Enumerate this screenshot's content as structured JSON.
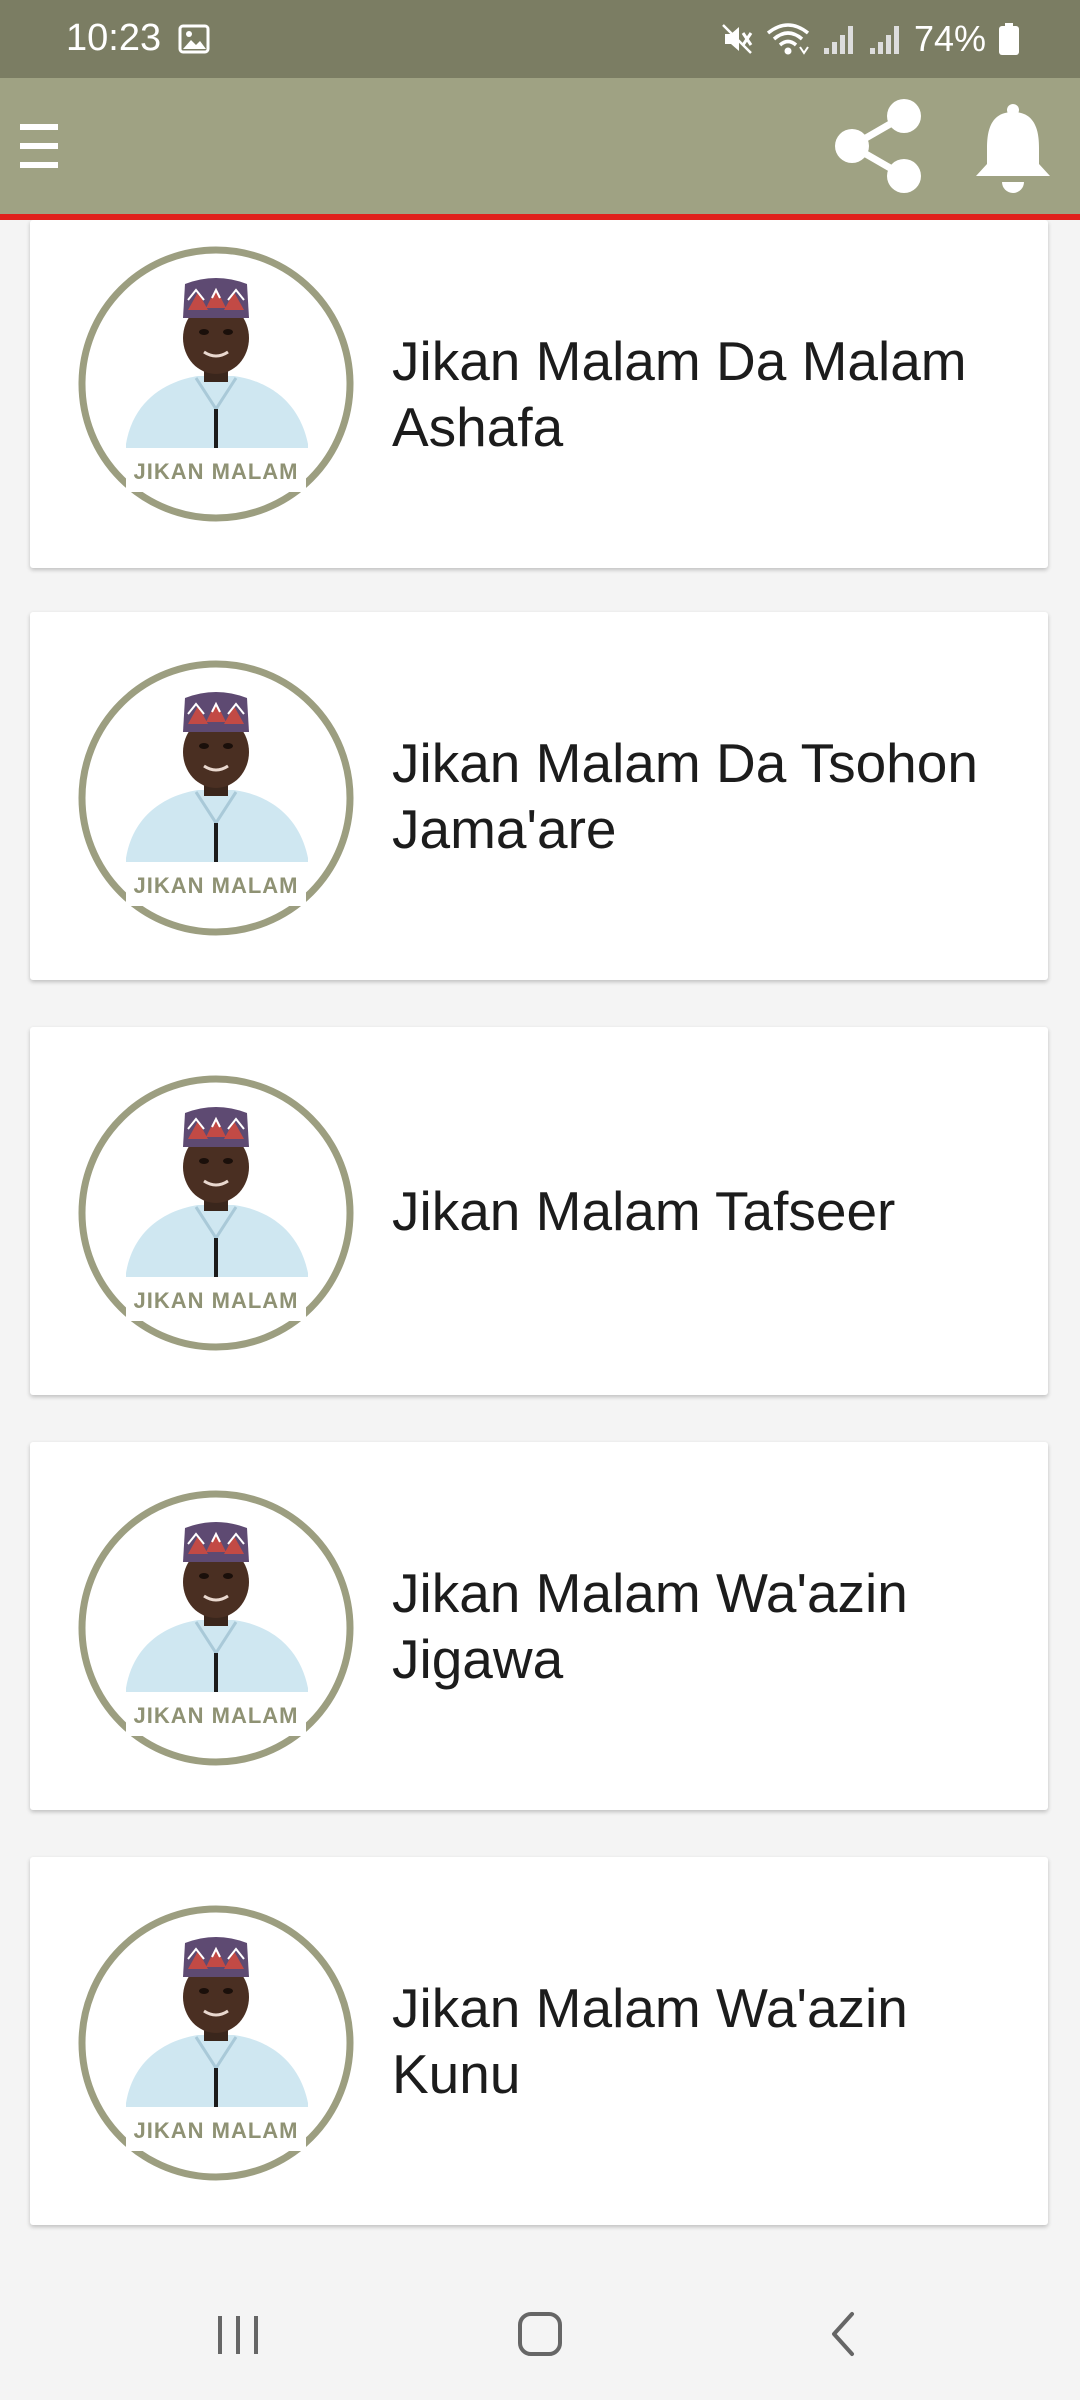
{
  "status_bar": {
    "time": "10:23",
    "battery": "74%",
    "icons": [
      "gallery-icon",
      "mute-icon",
      "wifi-icon",
      "signal-icon",
      "signal-icon",
      "battery-icon"
    ]
  },
  "app_bar": {
    "icons": [
      "menu-icon",
      "share-icon",
      "bell-icon"
    ],
    "background": "#9fa283",
    "accent_line": "#e0201c"
  },
  "list": {
    "items": [
      {
        "title": "Jikan Malam Da Malam Ashafa",
        "avatar_caption": "JIKAN MALAM"
      },
      {
        "title": "Jikan Malam Da Tsohon Jama'are",
        "avatar_caption": "JIKAN MALAM"
      },
      {
        "title": "Jikan Malam Tafseer",
        "avatar_caption": "JIKAN MALAM"
      },
      {
        "title": "Jikan Malam Wa'azin Jigawa",
        "avatar_caption": "JIKAN MALAM"
      },
      {
        "title": "Jikan Malam Wa'azin Kunu",
        "avatar_caption": "JIKAN MALAM"
      }
    ]
  },
  "nav_bar": {
    "icons": [
      "recent-apps-icon",
      "home-icon",
      "back-icon"
    ]
  },
  "colors": {
    "status_bar": "#7b7d63",
    "avatar_ring": "#9c9e80",
    "avatar_caption": "#8f9274"
  }
}
